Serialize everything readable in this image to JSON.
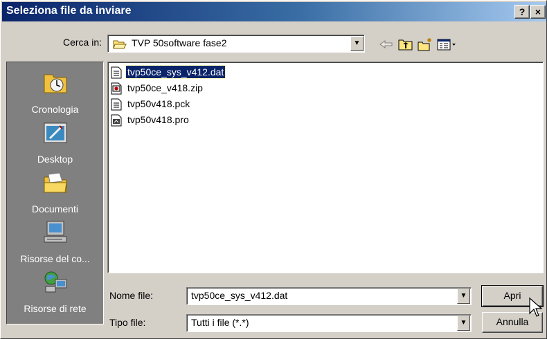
{
  "window": {
    "title": "Seleziona file da inviare",
    "help_label": "?",
    "close_label": "×"
  },
  "lookin": {
    "label": "Cerca in:",
    "value": "TVP 50software fase2",
    "arrow": "▼"
  },
  "toolbar": {
    "icons": [
      "back-icon",
      "up-folder-icon",
      "new-folder-icon",
      "view-menu-icon"
    ]
  },
  "places": [
    {
      "label": "Cronologia",
      "icon": "history-icon"
    },
    {
      "label": "Desktop",
      "icon": "desktop-icon"
    },
    {
      "label": "Documenti",
      "icon": "documents-folder-icon"
    },
    {
      "label": "Risorse del co...",
      "icon": "my-computer-icon"
    },
    {
      "label": "Risorse di rete",
      "icon": "network-places-icon"
    }
  ],
  "files": [
    {
      "name": "tvp50ce_sys_v412.dat",
      "icon": "text-file-icon",
      "selected": true
    },
    {
      "name": "tvp50ce_v418.zip",
      "icon": "zip-archive-icon",
      "selected": false
    },
    {
      "name": "tvp50v418.pck",
      "icon": "text-file-icon",
      "selected": false
    },
    {
      "name": "tvp50v418.pro",
      "icon": "program-file-icon",
      "selected": false
    }
  ],
  "filename": {
    "label": "Nome file:",
    "value": "tvp50ce_sys_v412.dat",
    "arrow": "▼"
  },
  "filetype": {
    "label": "Tipo file:",
    "value": "Tutti i file (*.*)",
    "arrow": "▼"
  },
  "buttons": {
    "open": "Apri",
    "cancel": "Annulla"
  },
  "colors": {
    "title_start": "#0a246a",
    "title_end": "#a6caf0",
    "selection": "#0a246a",
    "face": "#d4d0c8",
    "places_bg": "#808080"
  }
}
